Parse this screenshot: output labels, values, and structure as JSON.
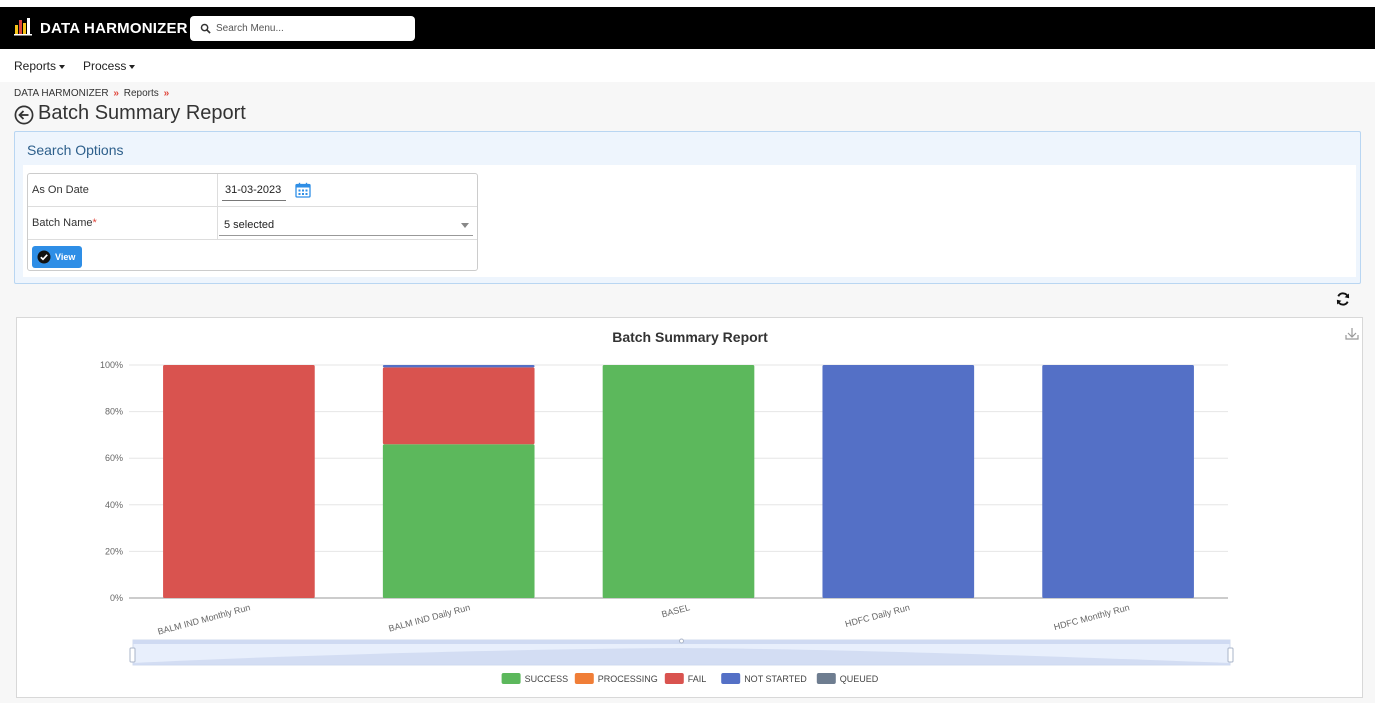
{
  "app": {
    "brand": "DATA HARMONIZER",
    "search_placeholder": "Search Menu..."
  },
  "menu": {
    "items": [
      {
        "label": "Reports"
      },
      {
        "label": "Process"
      }
    ]
  },
  "breadcrumb": {
    "items": [
      "DATA HARMONIZER",
      "Reports"
    ],
    "separator": "»"
  },
  "page": {
    "title": "Batch Summary Report"
  },
  "search_options": {
    "title": "Search Options",
    "as_on_date_label": "As On Date",
    "as_on_date_value": "31-03-2023",
    "batch_name_label": "Batch Name",
    "batch_name_required": "*",
    "batch_name_value": "5 selected",
    "view_button": "View"
  },
  "colors": {
    "accent": "#2e8ee6",
    "success": "#5cb85c",
    "processing": "#f07e37",
    "fail": "#d9534f",
    "not_started": "#5470c6",
    "queued": "#6e7d90"
  },
  "chart_data": {
    "type": "bar",
    "stacked": true,
    "title": "Batch Summary Report",
    "categories": [
      "BALM IND Monthly Run",
      "BALM IND Daily Run",
      "BASEL",
      "HDFC Daily Run",
      "HDFC Monthly Run"
    ],
    "series": [
      {
        "name": "SUCCESS",
        "color": "#5cb85c",
        "values": [
          0,
          66,
          100,
          0,
          0
        ]
      },
      {
        "name": "PROCESSING",
        "color": "#f07e37",
        "values": [
          0,
          0,
          0,
          0,
          0
        ]
      },
      {
        "name": "FAIL",
        "color": "#d9534f",
        "values": [
          100,
          33,
          0,
          0,
          0
        ]
      },
      {
        "name": "NOT STARTED",
        "color": "#5470c6",
        "values": [
          0,
          1,
          0,
          100,
          100
        ]
      },
      {
        "name": "QUEUED",
        "color": "#6e7d90",
        "values": [
          0,
          0,
          0,
          0,
          0
        ]
      }
    ],
    "y_ticks": [
      "0%",
      "20%",
      "40%",
      "60%",
      "80%",
      "100%"
    ],
    "ylim": [
      0,
      100
    ],
    "grid": true,
    "legend": "bottom",
    "datazoom": true
  }
}
